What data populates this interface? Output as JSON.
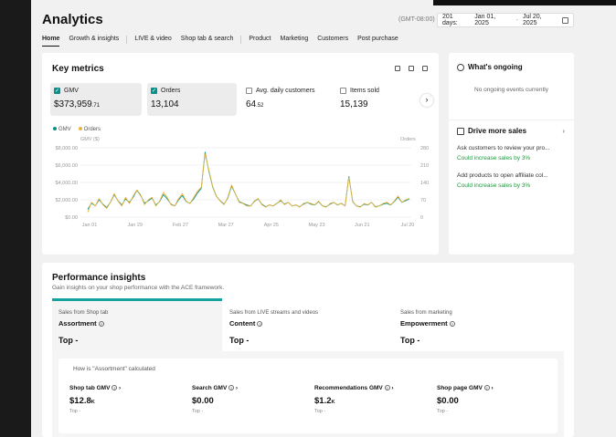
{
  "header": {
    "title": "Analytics",
    "timezone": "(GMT-08:00)",
    "range_days": "201 days:",
    "date_start": "Jan 01, 2025",
    "date_sep": "-",
    "date_end": "Jul 20, 2025"
  },
  "nav": [
    "Home",
    "Growth & insights",
    "LIVE & video",
    "Shop tab & search",
    "Product",
    "Marketing",
    "Customers",
    "Post purchase"
  ],
  "key_metrics": {
    "title": "Key metrics",
    "metrics": [
      {
        "label": "GMV",
        "value": "$373,959",
        "decimals": ".71",
        "checked": true
      },
      {
        "label": "Orders",
        "value": "13,104",
        "decimals": "",
        "checked": true
      },
      {
        "label": "Avg. daily customers",
        "value": "64",
        "decimals": ".52",
        "checked": false
      },
      {
        "label": "Items sold",
        "value": "15,139",
        "decimals": "",
        "checked": false
      }
    ],
    "next_arrow": "›"
  },
  "chart_data": {
    "type": "line",
    "legend": [
      "GMV",
      "Orders"
    ],
    "y_left_label": "GMV ($)",
    "y_right_label": "Orders",
    "y_left_ticks": [
      "$8,000.00",
      "$6,000.00",
      "$4,000.00",
      "$2,000.00",
      "$0.00"
    ],
    "y_right_ticks": [
      "280",
      "210",
      "140",
      "70",
      "0"
    ],
    "x_ticks": [
      "Jan 01",
      "Jan 29",
      "Feb 27",
      "Mar 27",
      "Apr 25",
      "May 23",
      "Jun 21",
      "Jul 20"
    ],
    "ylim_left": [
      0,
      8000
    ],
    "ylim_right": [
      0,
      280
    ],
    "series": [
      {
        "name": "GMV",
        "color": "#0a8f8a",
        "values": [
          900,
          1600,
          1300,
          2000,
          1500,
          1100,
          1700,
          2600,
          1900,
          1400,
          2100,
          1700,
          2300,
          3100,
          2500,
          1600,
          1900,
          2200,
          1400,
          1800,
          2600,
          2100,
          1500,
          1300,
          2000,
          2500,
          1800,
          1600,
          2100,
          2800,
          3300,
          7500,
          5300,
          3500,
          2400,
          1900,
          1500,
          2200,
          3600,
          2700,
          1800,
          1600,
          1400,
          1300,
          1800,
          2100,
          1500,
          1200,
          1400,
          1300,
          1600,
          1900,
          1500,
          1700,
          1300,
          1400,
          1200,
          1500,
          1700,
          1500,
          1400,
          1800,
          1300,
          1200,
          1500,
          1700,
          1400,
          1600,
          1300,
          4700,
          1800,
          1300,
          1200,
          1500,
          1400,
          1700,
          1200,
          1300,
          1500,
          1600,
          1400,
          1800,
          2300,
          1700,
          1900,
          2100
        ]
      },
      {
        "name": "Orders",
        "color": "#e8b53d",
        "values": [
          20,
          60,
          45,
          75,
          50,
          35,
          60,
          95,
          65,
          45,
          80,
          55,
          85,
          110,
          90,
          50,
          70,
          80,
          45,
          65,
          100,
          80,
          50,
          45,
          75,
          95,
          65,
          55,
          80,
          105,
          120,
          255,
          190,
          125,
          85,
          65,
          50,
          80,
          130,
          95,
          60,
          55,
          45,
          45,
          65,
          75,
          50,
          40,
          50,
          45,
          55,
          70,
          50,
          60,
          45,
          50,
          40,
          55,
          60,
          55,
          50,
          65,
          45,
          40,
          55,
          60,
          50,
          55,
          45,
          160,
          65,
          45,
          40,
          55,
          50,
          60,
          40,
          45,
          55,
          60,
          50,
          65,
          85,
          60,
          70,
          75
        ]
      }
    ]
  },
  "ongoing": {
    "title": "What's ongoing",
    "empty": "No ongoing events currently"
  },
  "drive_sales": {
    "title": "Drive more sales",
    "chevron": "›",
    "items": [
      {
        "text": "Ask customers to review your pro...",
        "note": "Could increase sales by 3%"
      },
      {
        "text": "Add products to open affiliate col...",
        "note": "Could increase sales by 3%"
      }
    ]
  },
  "performance": {
    "title": "Performance insights",
    "subtitle": "Gain insights on your shop performance with the ACE framework.",
    "tabs": [
      {
        "source": "Sales from Shop tab",
        "name": "Assortment",
        "rank": "Top -"
      },
      {
        "source": "Sales from LIVE streams and videos",
        "name": "Content",
        "rank": "Top -"
      },
      {
        "source": "Sales from marketing",
        "name": "Empowerment",
        "rank": "Top -"
      }
    ],
    "calc_label": "How is \"Assortment\" calculated",
    "sub_metrics": [
      {
        "label": "Shop tab GMV",
        "value": "$12.8",
        "unit": "K",
        "rank": "Top -"
      },
      {
        "label": "Search GMV",
        "value": "$0.00",
        "unit": "",
        "rank": "Top -"
      },
      {
        "label": "Recommendations GMV",
        "value": "$1.2",
        "unit": "K",
        "rank": "Top -"
      },
      {
        "label": "Shop page GMV",
        "value": "$0.00",
        "unit": "",
        "rank": "Top -"
      }
    ]
  }
}
